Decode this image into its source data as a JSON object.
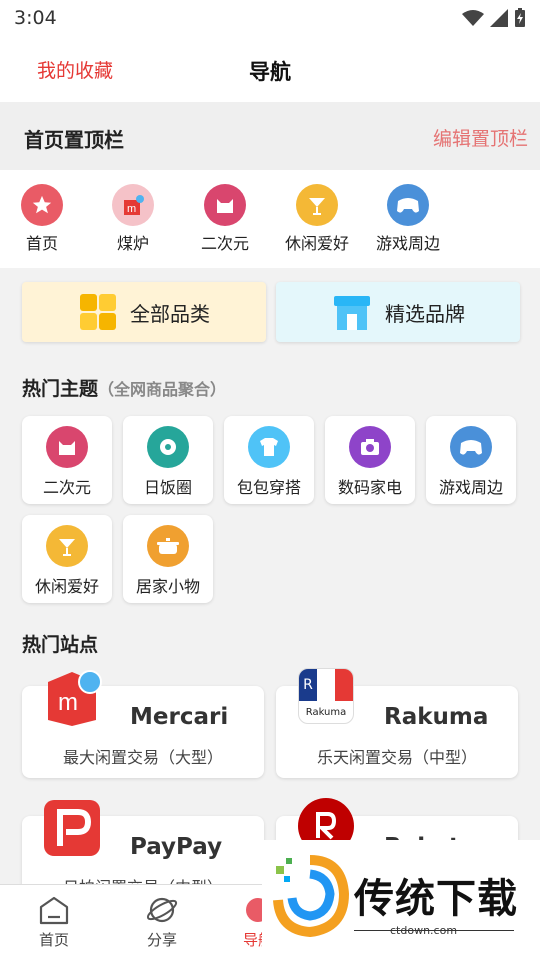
{
  "status": {
    "time": "3:04"
  },
  "header": {
    "favorites": "我的收藏",
    "title": "导航"
  },
  "pinned": {
    "title": "首页置顶栏",
    "edit": "编辑置顶栏",
    "items": [
      {
        "label": "首页",
        "icon": "star-icon",
        "color": "#e95b66"
      },
      {
        "label": "煤炉",
        "icon": "mercari-icon",
        "color": "#f5c2c8"
      },
      {
        "label": "二次元",
        "icon": "cat-icon",
        "color": "#d9466e"
      },
      {
        "label": "休闲爱好",
        "icon": "drink-icon",
        "color": "#f4b836"
      },
      {
        "label": "游戏周边",
        "icon": "gamepad-icon",
        "color": "#4a90d9"
      }
    ]
  },
  "categories": {
    "all": "全部品类",
    "brands": "精选品牌"
  },
  "topics": {
    "title": "热门主题",
    "subtitle": "（全网商品聚合）",
    "items": [
      {
        "label": "二次元",
        "icon": "cat-icon",
        "color": "#d9466e"
      },
      {
        "label": "日饭圈",
        "icon": "leaf-icon",
        "color": "#26a69a"
      },
      {
        "label": "包包穿搭",
        "icon": "shirt-icon",
        "color": "#4fc3f7"
      },
      {
        "label": "数码家电",
        "icon": "camera-icon",
        "color": "#8e44c9"
      },
      {
        "label": "游戏周边",
        "icon": "gamepad-icon",
        "color": "#4a90d9"
      },
      {
        "label": "休闲爱好",
        "icon": "drink-icon",
        "color": "#f4b836"
      },
      {
        "label": "居家小物",
        "icon": "pot-icon",
        "color": "#f0a030"
      }
    ]
  },
  "sites": {
    "title": "热门站点",
    "items": [
      {
        "name": "Mercari",
        "desc": "最大闲置交易（大型）",
        "logo_color": "#e53935"
      },
      {
        "name": "Rakuma",
        "desc": "乐天闲置交易（中型）",
        "logo_text": "Rakuma",
        "logo_color": "#1a3b8c"
      },
      {
        "name": "PayPay",
        "desc": "日拍闲置交易（中型）",
        "logo_color": "#e53935"
      },
      {
        "name": "Rakuten",
        "desc": "",
        "logo_color": "#bf0000"
      }
    ]
  },
  "tabs": [
    {
      "label": "首页",
      "icon": "home-icon"
    },
    {
      "label": "分享",
      "icon": "planet-icon"
    },
    {
      "label": "导航",
      "icon": "nav-icon"
    }
  ],
  "watermark": {
    "text": "传统下载",
    "url": "ctdown.com"
  }
}
